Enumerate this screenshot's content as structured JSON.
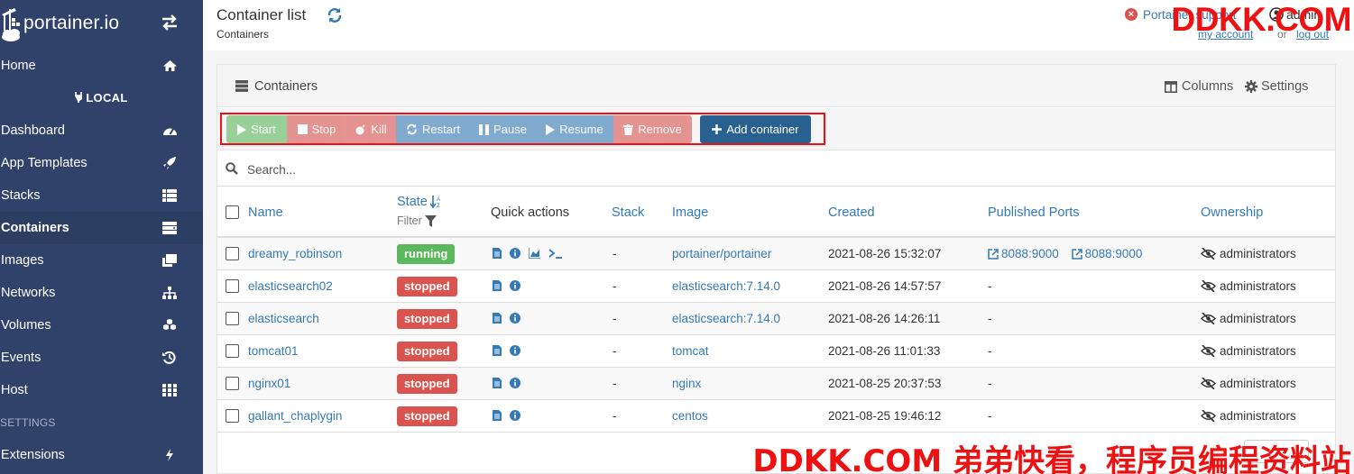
{
  "brand": {
    "name": "portainer.io"
  },
  "sidebar": {
    "environment": "LOCAL",
    "items": [
      {
        "label": "Home",
        "icon": "home-icon"
      },
      {
        "label": "Dashboard",
        "icon": "tachometer-icon"
      },
      {
        "label": "App Templates",
        "icon": "rocket-icon"
      },
      {
        "label": "Stacks",
        "icon": "th-list-icon"
      },
      {
        "label": "Containers",
        "icon": "server-icon"
      },
      {
        "label": "Images",
        "icon": "clone-icon"
      },
      {
        "label": "Networks",
        "icon": "sitemap-icon"
      },
      {
        "label": "Volumes",
        "icon": "cubes-icon"
      },
      {
        "label": "Events",
        "icon": "history-icon"
      },
      {
        "label": "Host",
        "icon": "th-icon"
      }
    ],
    "section_label": "SETTINGS",
    "extensions": {
      "label": "Extensions",
      "icon": "bolt-icon"
    }
  },
  "header": {
    "title": "Container list",
    "breadcrumb": "Containers",
    "support_text": "Portainer support",
    "user": "admin",
    "my_account": "my account",
    "or": "or",
    "log_out": "log out"
  },
  "panel": {
    "title": "Containers",
    "columns_label": "Columns",
    "settings_label": "Settings"
  },
  "actions": {
    "start": "Start",
    "stop": "Stop",
    "kill": "Kill",
    "restart": "Restart",
    "pause": "Pause",
    "resume": "Resume",
    "remove": "Remove",
    "add": "Add container"
  },
  "search": {
    "placeholder": "Search..."
  },
  "table": {
    "headers": {
      "name": "Name",
      "state": "State",
      "filter": "Filter",
      "quick_actions": "Quick actions",
      "stack": "Stack",
      "image": "Image",
      "created": "Created",
      "ports": "Published Ports",
      "ownership": "Ownership"
    },
    "rows": [
      {
        "name": "dreamy_robinson",
        "state": "running",
        "stack": "-",
        "image": "portainer/portainer",
        "created": "2021-08-26 15:32:07",
        "ports": [
          "8088:9000",
          "8088:9000"
        ],
        "ownership": "administrators"
      },
      {
        "name": "elasticsearch02",
        "state": "stopped",
        "stack": "-",
        "image": "elasticsearch:7.14.0",
        "created": "2021-08-26 14:57:57",
        "ports_text": "-",
        "ownership": "administrators"
      },
      {
        "name": "elasticsearch",
        "state": "stopped",
        "stack": "-",
        "image": "elasticsearch:7.14.0",
        "created": "2021-08-26 14:26:11",
        "ports_text": "-",
        "ownership": "administrators"
      },
      {
        "name": "tomcat01",
        "state": "stopped",
        "stack": "-",
        "image": "tomcat",
        "created": "2021-08-26 11:01:33",
        "ports_text": "-",
        "ownership": "administrators"
      },
      {
        "name": "nginx01",
        "state": "stopped",
        "stack": "-",
        "image": "nginx",
        "created": "2021-08-25 20:37:53",
        "ports_text": "-",
        "ownership": "administrators"
      },
      {
        "name": "gallant_chaplygin",
        "state": "stopped",
        "stack": "-",
        "image": "centos",
        "created": "2021-08-25 19:46:12",
        "ports_text": "-",
        "ownership": "administrators"
      }
    ]
  },
  "watermarks": {
    "top": "DDKK.COM",
    "bottom": "DDKK.COM 弟弟快看，程序员编程资料站"
  },
  "colors": {
    "sidebar": "#30426a",
    "primary": "#337ab7",
    "success": "#5cb85c",
    "danger": "#d9534f",
    "highlight": "#ee1111"
  }
}
